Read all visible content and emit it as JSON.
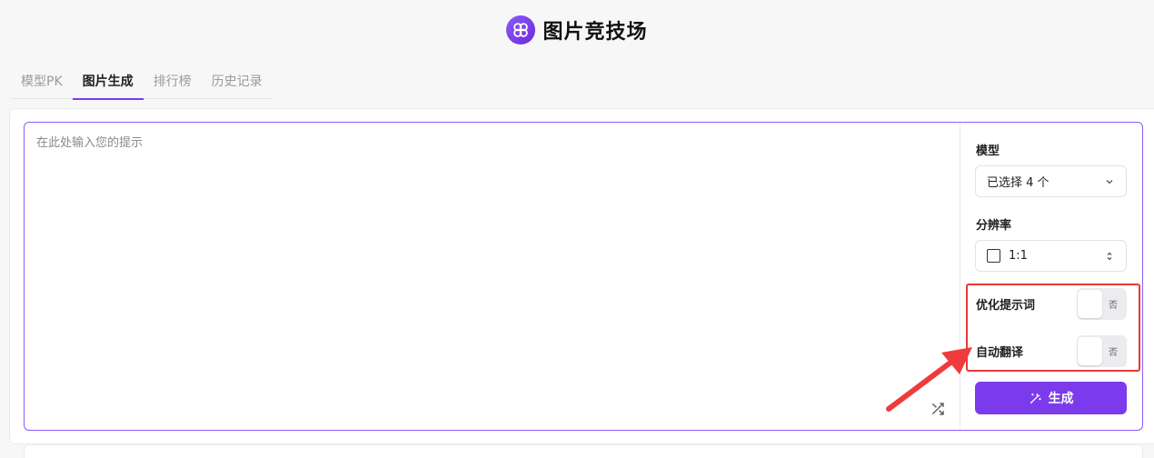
{
  "app": {
    "title": "图片竞技场",
    "logo_icon": "flower-logo-icon"
  },
  "tabs": [
    {
      "label": "模型PK",
      "active": false
    },
    {
      "label": "图片生成",
      "active": true
    },
    {
      "label": "排行榜",
      "active": false
    },
    {
      "label": "历史记录",
      "active": false
    }
  ],
  "prompt": {
    "placeholder": "在此处输入您的提示",
    "value": "",
    "shuffle_icon": "shuffle-icon"
  },
  "sidebar": {
    "model_label": "模型",
    "model_value": "已选择 4 个",
    "resolution_label": "分辨率",
    "resolution_value": "1:1",
    "optimize_label": "优化提示词",
    "optimize_state": "否",
    "translate_label": "自动翻译",
    "translate_state": "否",
    "generate_label": "生成"
  },
  "colors": {
    "accent": "#7c3aed",
    "highlight": "#e53935"
  }
}
